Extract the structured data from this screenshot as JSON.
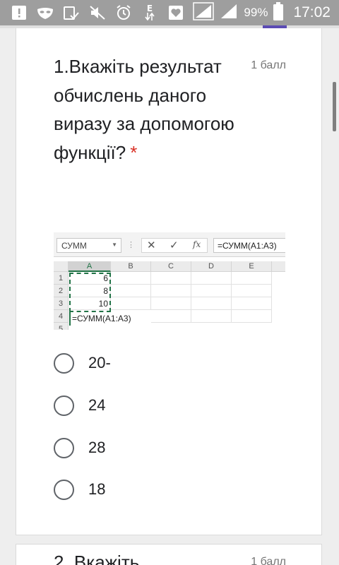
{
  "statusbar": {
    "battery": "99%",
    "time": "17:02",
    "icons": [
      "notification-alert-icon",
      "mask-icon",
      "task-check-icon",
      "mute-icon",
      "alarm-icon",
      "data-transfer-icon",
      "heart-icon",
      "signal-icon",
      "signal-icon-2",
      "battery-icon"
    ],
    "data_icon_text": "E"
  },
  "question1": {
    "title": "1.Вкажіть результат обчислень даного виразу за допомогою функції?",
    "required_marker": "*",
    "points": "1 балл",
    "excel": {
      "name_box": "СУММ",
      "formula": "=СУММ(A1:A3)",
      "columns": [
        "A",
        "B",
        "C",
        "D",
        "E"
      ],
      "rows": [
        "1",
        "2",
        "3",
        "4",
        "5"
      ],
      "values": [
        "6",
        "8",
        "10"
      ],
      "formula_cell": "=СУММ(A1:A3)"
    },
    "options": [
      "20-",
      "24",
      "28",
      "18"
    ]
  },
  "question2": {
    "title": "2. Вкажіть",
    "points": "1 балл"
  }
}
